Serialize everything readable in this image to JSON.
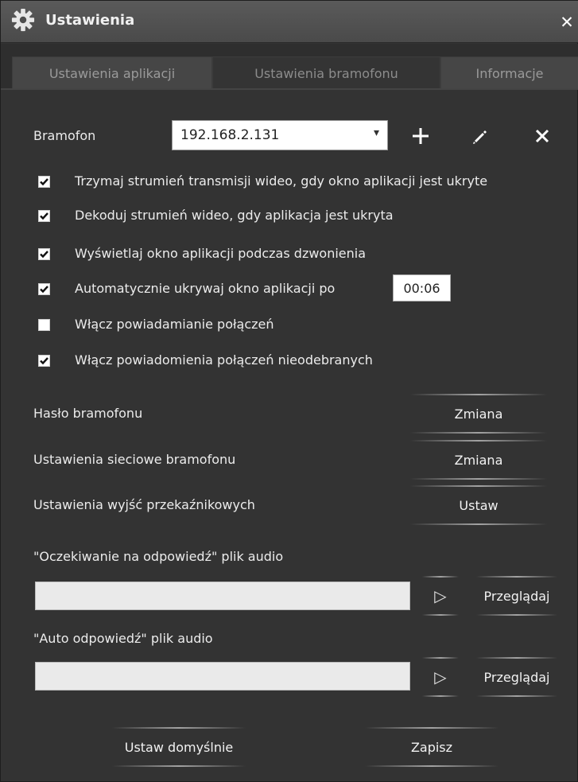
{
  "window": {
    "title": "Ustawienia",
    "close_label": "✕"
  },
  "tabs": [
    {
      "label": "Ustawienia aplikacji"
    },
    {
      "label": "Ustawienia bramofonu"
    },
    {
      "label": "Informacje"
    }
  ],
  "bramofon": {
    "label": "Bramofon",
    "selected": "192.168.2.131",
    "add_icon": "plus-icon",
    "edit_icon": "pencil-icon",
    "delete_icon": "close-icon"
  },
  "options": [
    {
      "label": "Trzymaj strumień transmisji wideo, gdy okno aplikacji jest ukryte",
      "checked": true
    },
    {
      "label": "Dekoduj strumień wideo, gdy aplikacja jest ukryta",
      "checked": true
    },
    {
      "label": "Wyświetlaj okno aplikacji podczas dzwonienia",
      "checked": true
    },
    {
      "label": "Automatycznie ukrywaj okno aplikacji po",
      "checked": true
    },
    {
      "label": "Włącz powiadamianie połączeń",
      "checked": false
    },
    {
      "label": "Włącz powiadomienia połączeń nieodebranych",
      "checked": true
    }
  ],
  "auto_hide_time": "00:06",
  "settings_rows": [
    {
      "label": "Hasło bramofonu",
      "button": "Zmiana"
    },
    {
      "label": "Ustawienia sieciowe bramofonu",
      "button": "Zmiana"
    },
    {
      "label": "Ustawienia wyjść przekaźnikowych",
      "button": "Ustaw"
    }
  ],
  "audio": [
    {
      "label": "\"Oczekiwanie na odpowiedź\" plik audio",
      "value": "",
      "play": "▷",
      "browse": "Przeglądaj"
    },
    {
      "label": "\"Auto odpowiedź\" plik audio",
      "value": "",
      "play": "▷",
      "browse": "Przeglądaj"
    }
  ],
  "footer": {
    "defaults_label": "Ustaw domyślnie",
    "save_label": "Zapisz"
  },
  "colors": {
    "background": "#333333",
    "titlebar": "#4a4a4a",
    "text": "#ececec"
  }
}
